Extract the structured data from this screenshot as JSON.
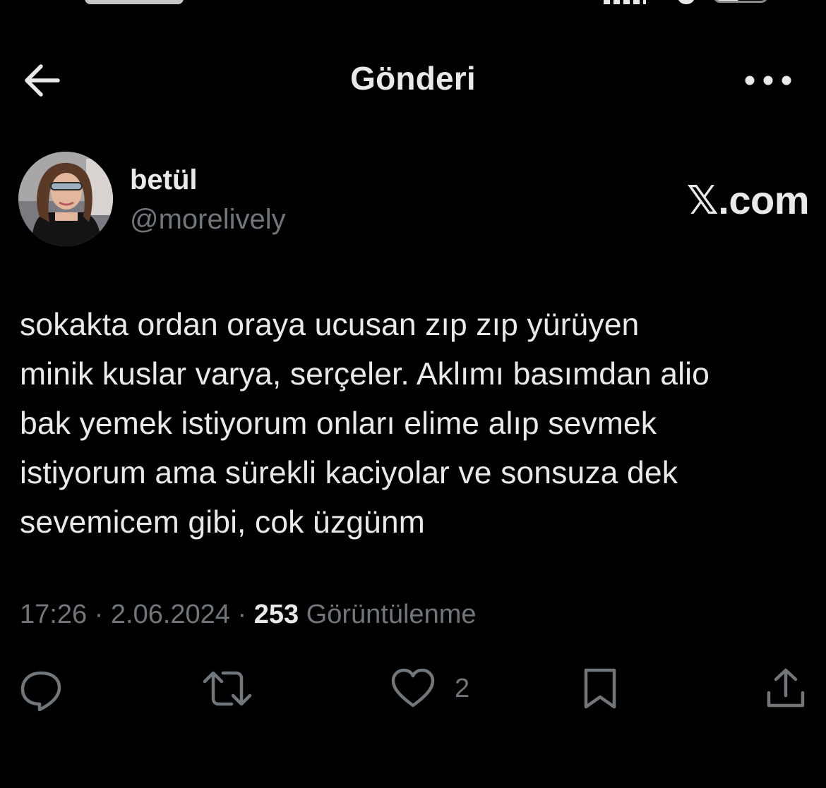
{
  "header": {
    "title": "Gönderi",
    "back_icon": "arrow-left-icon",
    "more_icon": "more-horizontal-icon"
  },
  "author": {
    "display_name": "betül",
    "handle": "@morelively",
    "avatar": "profile-photo"
  },
  "source_label": "𝕏.com",
  "tweet": {
    "text": "sokakta ordan oraya ucusan zıp zıp yürüyen\nminik kuslar varya, serçeler. Aklımı basımdan alio\nbak yemek istiyorum onları elime alıp sevmek\nistiyorum ama sürekli kaciyolar ve sonsuza dek\nsevemicem gibi, cok üzgünm"
  },
  "meta": {
    "time": "17:26",
    "separator": " · ",
    "date": "2.06.2024",
    "views_count": "253",
    "views_label": "Görüntülenme"
  },
  "actions": {
    "reply_icon": "reply-icon",
    "repost_icon": "repost-icon",
    "like_icon": "heart-icon",
    "like_count": "2",
    "bookmark_icon": "bookmark-icon",
    "share_icon": "share-icon"
  },
  "colors": {
    "background": "#000000",
    "text_primary": "#e7e9ea",
    "text_secondary": "#71767b"
  }
}
